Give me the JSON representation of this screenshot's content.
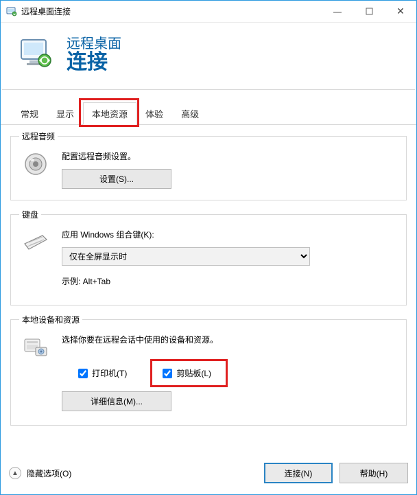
{
  "window": {
    "title": "远程桌面连接"
  },
  "brand": {
    "line1": "远程桌面",
    "line2": "连接"
  },
  "tabs": {
    "general": "常规",
    "display": "显示",
    "local_resources": "本地资源",
    "experience": "体验",
    "advanced": "高级",
    "active": "local_resources"
  },
  "audio": {
    "legend": "远程音频",
    "desc": "配置远程音频设置。",
    "settings_button": "设置(S)..."
  },
  "keyboard": {
    "legend": "键盘",
    "label": "应用 Windows 组合键(K):",
    "selected": "仅在全屏显示时",
    "example": "示例: Alt+Tab"
  },
  "devices": {
    "legend": "本地设备和资源",
    "desc": "选择你要在远程会话中使用的设备和资源。",
    "printer_label": "打印机(T)",
    "printer_checked": true,
    "clipboard_label": "剪贴板(L)",
    "clipboard_checked": true,
    "details_button": "详细信息(M)..."
  },
  "footer": {
    "hide_options": "隐藏选项(O)",
    "connect": "连接(N)",
    "help": "帮助(H)"
  }
}
